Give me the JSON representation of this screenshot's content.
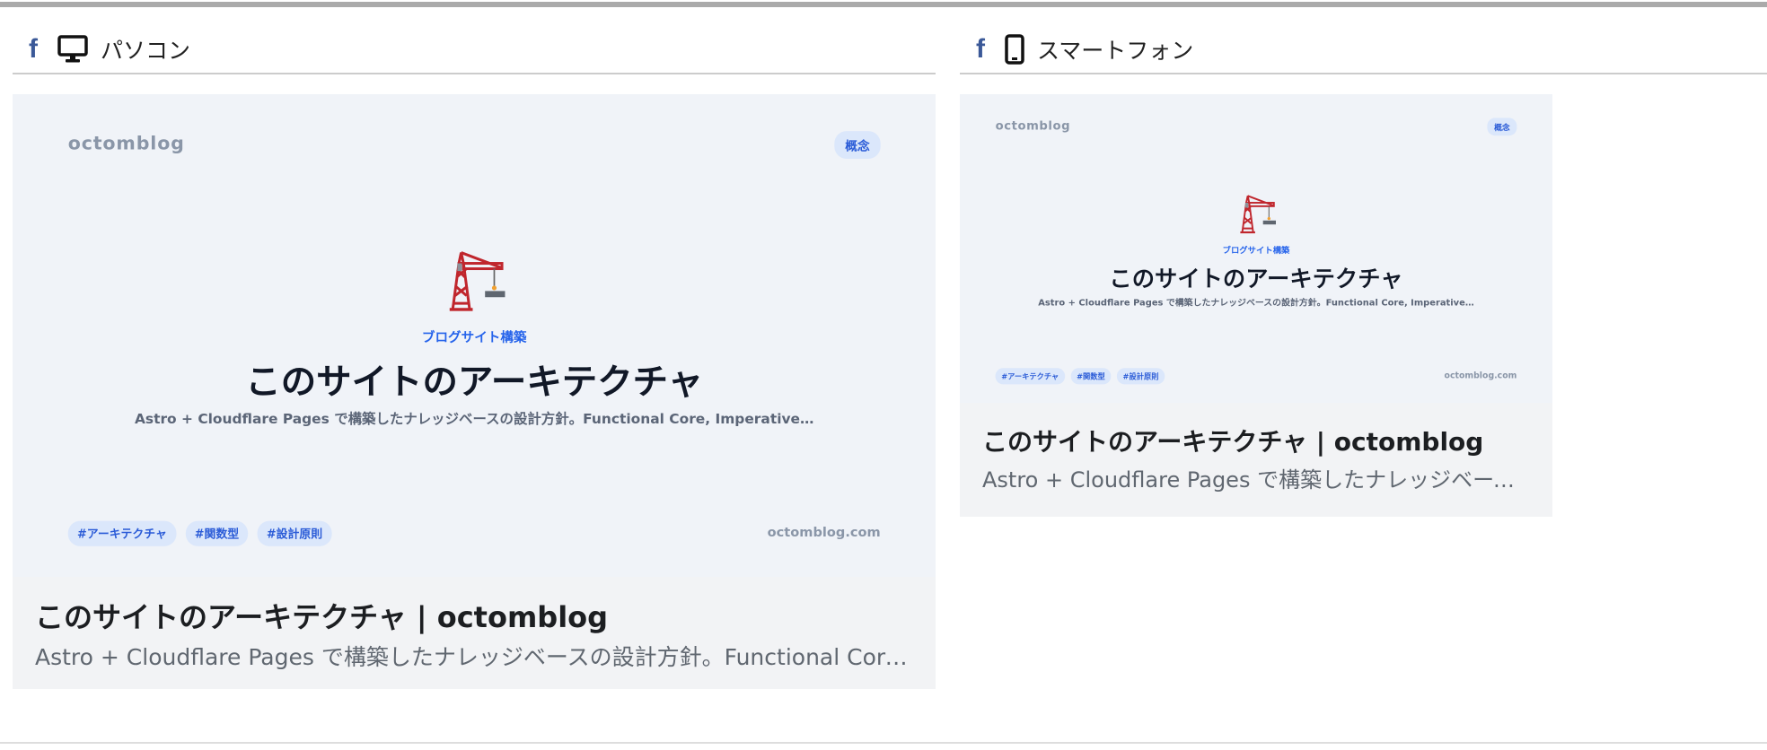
{
  "sections": [
    {
      "label": "パソコン",
      "device_icon": "monitor-icon",
      "platform_icon": "facebook-icon"
    },
    {
      "label": "スマートフォン",
      "device_icon": "smartphone-icon",
      "platform_icon": "facebook-icon"
    }
  ],
  "og_image": {
    "brand": "octomblog",
    "badge": "概念",
    "icon": "construction-crane-icon",
    "category": "ブログサイト構築",
    "title": "このサイトのアーキテクチャ",
    "description": "Astro + Cloudflare Pages で構築したナレッジベースの設計方針。Functional Core, Imperative…",
    "tags": [
      "#アーキテクチャ",
      "#関数型",
      "#設計原則"
    ],
    "domain": "octomblog.com"
  },
  "preview": {
    "title": "このサイトのアーキテクチャ | octomblog",
    "description": "Astro + Cloudflare Pages で構築したナレッジベースの設計方針。Functional Core, Imperative Shell"
  },
  "colors": {
    "facebook": "#3b5998",
    "accent": "#2563eb",
    "tag_bg": "#dbe7fb",
    "card_bg": "#f0f3f8"
  }
}
